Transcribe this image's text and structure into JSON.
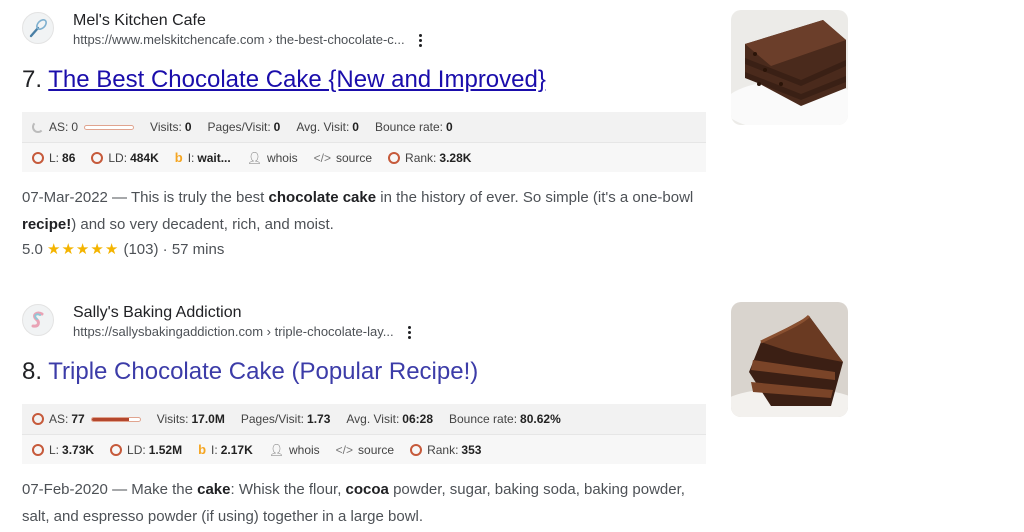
{
  "results": [
    {
      "site_name": "Mel's Kitchen Cafe",
      "url": "https://www.melskitchencafe.com › the-best-chocolate-c...",
      "number": "7.",
      "title": "The Best Chocolate Cake {New and Improved}",
      "seo_line1": {
        "as_label": "AS:",
        "as_value": "0",
        "as_fill": 0,
        "visits_label": "Visits:",
        "visits_value": "0",
        "pages_label": "Pages/Visit:",
        "pages_value": "0",
        "avg_label": "Avg. Visit:",
        "avg_value": "0",
        "bounce_label": "Bounce rate:",
        "bounce_value": "0"
      },
      "seo_line2": {
        "l_label": "L:",
        "l_value": "86",
        "ld_label": "LD:",
        "ld_value": "484K",
        "i_label": "I:",
        "i_value": "wait...",
        "whois": "whois",
        "source": "source",
        "rank_label": "Rank:",
        "rank_value": "3.28K"
      },
      "snippet": {
        "date": "07-Mar-2022",
        "dash": " — ",
        "p1": "This is truly the best ",
        "b1": "chocolate cake",
        "p2": " in the history of ever. So simple (it's a one-bowl ",
        "b2": "recipe!",
        "p3": ") and so very decadent, rich, and moist."
      },
      "rating": {
        "score": "5.0",
        "stars": "★★★★★",
        "count": "(103)",
        "time": "· 57 mins"
      }
    },
    {
      "site_name": "Sally's Baking Addiction",
      "url": "https://sallysbakingaddiction.com › triple-chocolate-lay...",
      "number": "8.",
      "title": "Triple Chocolate Cake (Popular Recipe!)",
      "seo_line1": {
        "as_label": "AS:",
        "as_value": "77",
        "as_fill": 0.77,
        "visits_label": "Visits:",
        "visits_value": "17.0M",
        "pages_label": "Pages/Visit:",
        "pages_value": "1.73",
        "avg_label": "Avg. Visit:",
        "avg_value": "06:28",
        "bounce_label": "Bounce rate:",
        "bounce_value": "80.62%"
      },
      "seo_line2": {
        "l_label": "L:",
        "l_value": "3.73K",
        "ld_label": "LD:",
        "ld_value": "1.52M",
        "i_label": "I:",
        "i_value": "2.17K",
        "whois": "whois",
        "source": "source",
        "rank_label": "Rank:",
        "rank_value": "353"
      },
      "snippet": {
        "date": "07-Feb-2020",
        "dash": " — ",
        "p1": "Make the ",
        "b1": "cake",
        "p2": ": Whisk the flour, ",
        "b2": "cocoa",
        "p3": " powder, sugar, baking soda, baking powder, salt, and espresso powder (if using) together in a large bowl."
      }
    }
  ],
  "colors": {
    "link": "#1a0dab",
    "ring": "#c65a3b",
    "star": "#f4b400",
    "bing": "#f5a623"
  },
  "icons": {
    "favicon_1": "whisk-icon",
    "favicon_2": "sallys-logo-icon",
    "thumb_1": "chocolate-cake-slice-image",
    "thumb_2": "triple-chocolate-cake-image"
  }
}
